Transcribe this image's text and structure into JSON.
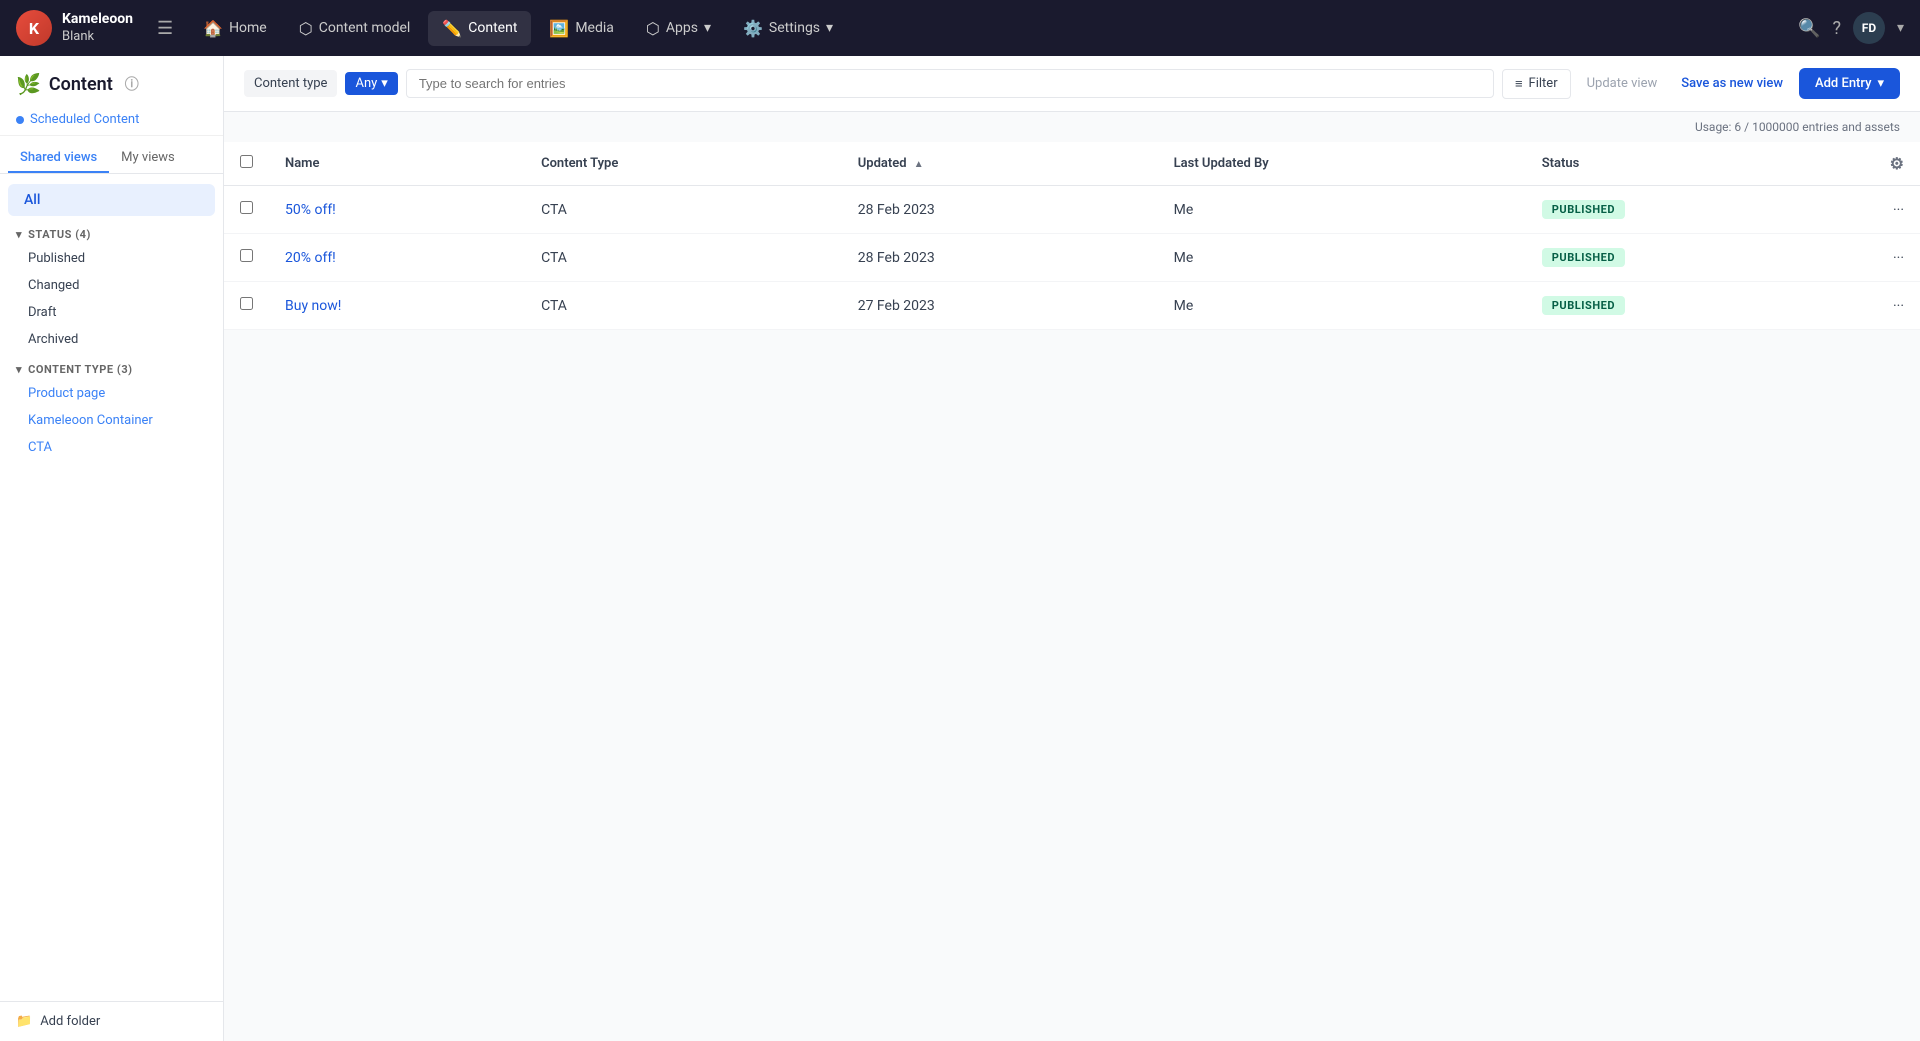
{
  "app": {
    "logo_initials": "K",
    "brand_name": "Kameleoon",
    "brand_sub": "Blank"
  },
  "nav": {
    "hamburger": "☰",
    "items": [
      {
        "id": "home",
        "label": "Home",
        "icon": "🏠",
        "active": false
      },
      {
        "id": "content-model",
        "label": "Content model",
        "icon": "⬡",
        "active": false
      },
      {
        "id": "content",
        "label": "Content",
        "icon": "✏️",
        "active": true
      },
      {
        "id": "media",
        "label": "Media",
        "icon": "🖼️",
        "active": false
      },
      {
        "id": "apps",
        "label": "Apps",
        "icon": "⬡",
        "active": false,
        "has_dropdown": true
      },
      {
        "id": "settings",
        "label": "Settings",
        "icon": "⚙️",
        "active": false,
        "has_dropdown": true
      }
    ],
    "search_icon": "🔍",
    "help_icon": "?",
    "avatar_initials": "FD"
  },
  "sidebar": {
    "title": "Content",
    "help_tooltip": "?",
    "scheduled_content_label": "Scheduled Content",
    "views_tabs": [
      {
        "id": "shared",
        "label": "Shared views",
        "active": true
      },
      {
        "id": "my",
        "label": "My views",
        "active": false
      }
    ],
    "all_label": "All",
    "status_section": {
      "label": "STATUS (4)",
      "items": [
        {
          "id": "published",
          "label": "Published"
        },
        {
          "id": "changed",
          "label": "Changed"
        },
        {
          "id": "draft",
          "label": "Draft"
        },
        {
          "id": "archived",
          "label": "Archived"
        }
      ]
    },
    "content_type_section": {
      "label": "CONTENT TYPE (3)",
      "items": [
        {
          "id": "product-page",
          "label": "Product page"
        },
        {
          "id": "kameleoon-container",
          "label": "Kameleoon Container"
        },
        {
          "id": "cta",
          "label": "CTA"
        }
      ]
    },
    "add_folder_label": "Add folder"
  },
  "toolbar": {
    "content_type_label": "Content type",
    "any_label": "Any",
    "search_placeholder": "Type to search for entries",
    "filter_label": "Filter",
    "update_view_label": "Update view",
    "save_view_label": "Save as new view",
    "add_entry_label": "Add Entry"
  },
  "table": {
    "usage_text": "Usage: 6 / 1000000 entries and assets",
    "columns": [
      {
        "id": "name",
        "label": "Name"
      },
      {
        "id": "content_type",
        "label": "Content Type"
      },
      {
        "id": "updated",
        "label": "Updated",
        "sortable": true,
        "sort_dir": "asc"
      },
      {
        "id": "last_updated_by",
        "label": "Last Updated By"
      },
      {
        "id": "status",
        "label": "Status"
      }
    ],
    "rows": [
      {
        "id": 1,
        "name": "50% off!",
        "content_type": "CTA",
        "updated": "28 Feb 2023",
        "last_updated_by": "Me",
        "status": "PUBLISHED"
      },
      {
        "id": 2,
        "name": "20% off!",
        "content_type": "CTA",
        "updated": "28 Feb 2023",
        "last_updated_by": "Me",
        "status": "PUBLISHED"
      },
      {
        "id": 3,
        "name": "Buy now!",
        "content_type": "CTA",
        "updated": "27 Feb 2023",
        "last_updated_by": "Me",
        "status": "PUBLISHED"
      }
    ]
  }
}
